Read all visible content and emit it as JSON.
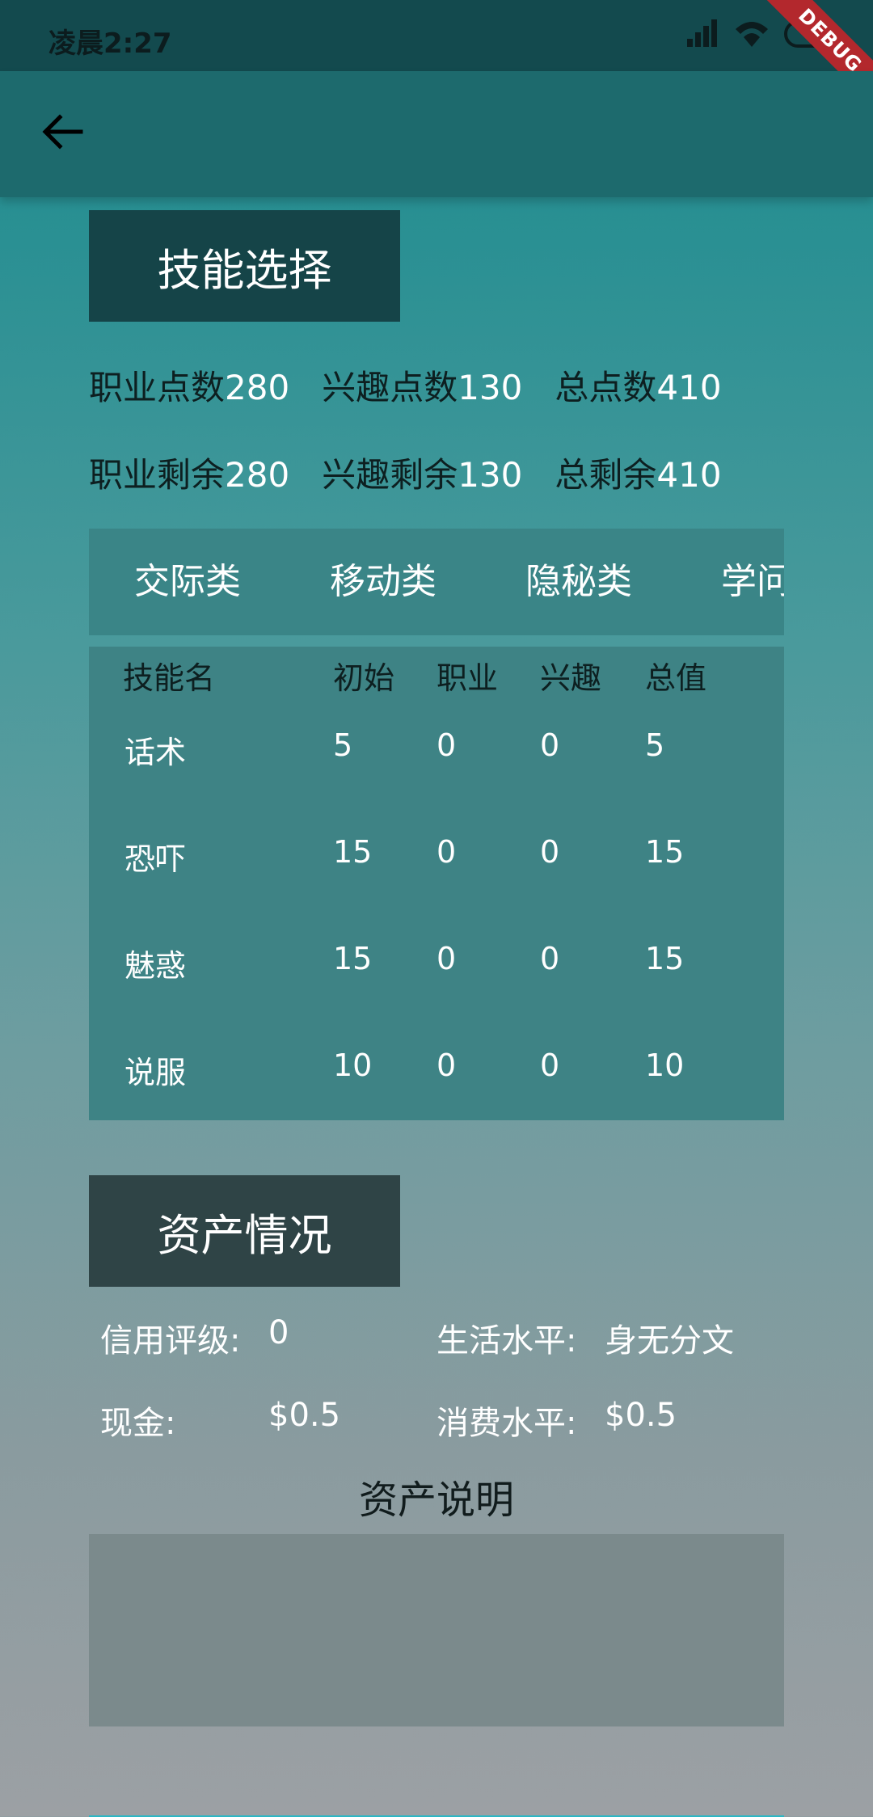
{
  "status_bar": {
    "time": "凌晨2:27",
    "debug": "DEBUG"
  },
  "skills": {
    "title": "技能选择",
    "points": [
      {
        "label": "职业点数",
        "value": "280"
      },
      {
        "label": "兴趣点数",
        "value": "130"
      },
      {
        "label": "总点数",
        "value": "410"
      }
    ],
    "remaining": [
      {
        "label": "职业剩余",
        "value": "280"
      },
      {
        "label": "兴趣剩余",
        "value": "130"
      },
      {
        "label": "总剩余",
        "value": "410"
      }
    ],
    "tabs": [
      "交际类",
      "移动类",
      "隐秘类",
      "学问"
    ],
    "table": {
      "headers": [
        "技能名",
        "初始",
        "职业",
        "兴趣",
        "总值"
      ],
      "rows": [
        [
          "话术",
          "5",
          "0",
          "0",
          "5"
        ],
        [
          "恐吓",
          "15",
          "0",
          "0",
          "15"
        ],
        [
          "魅惑",
          "15",
          "0",
          "0",
          "15"
        ],
        [
          "说服",
          "10",
          "0",
          "0",
          "10"
        ]
      ]
    }
  },
  "assets": {
    "title": "资产情况",
    "credit_label": "信用评级:",
    "credit_value": "0",
    "living_label": "生活水平:",
    "living_value": "身无分文",
    "cash_label": "现金:",
    "cash_value": "$0.5",
    "spending_label": "消费水平:",
    "spending_value": "$0.5",
    "desc_title": "资产说明"
  },
  "colors": {
    "accent": "#2bb7c5",
    "header_dark": "#154448"
  }
}
